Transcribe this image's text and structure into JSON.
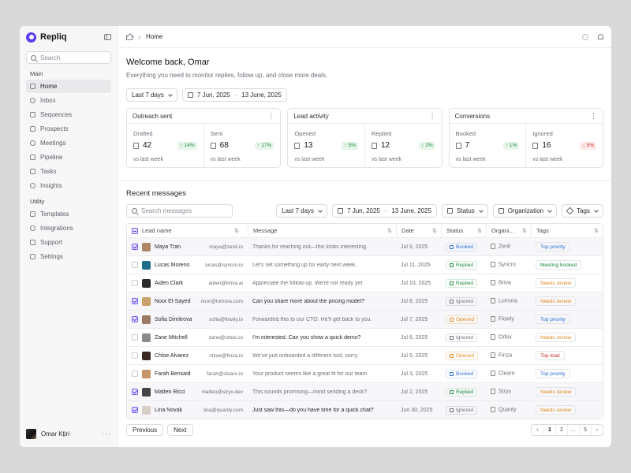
{
  "brand": {
    "name": "Repliq",
    "color": "#5b3df5"
  },
  "sidebar": {
    "search_placeholder": "Search",
    "main_label": "Main",
    "main_items": [
      {
        "label": "Home",
        "icon": "home-icon"
      },
      {
        "label": "Inbox",
        "icon": "inbox-icon"
      },
      {
        "label": "Sequences",
        "icon": "sequences-icon"
      },
      {
        "label": "Prospects",
        "icon": "prospects-icon"
      },
      {
        "label": "Meetings",
        "icon": "calendar-icon"
      },
      {
        "label": "Pipeline",
        "icon": "pipeline-icon"
      },
      {
        "label": "Tasks",
        "icon": "tasks-icon"
      },
      {
        "label": "Insights",
        "icon": "chart-icon"
      }
    ],
    "utility_label": "Utility",
    "utility_items": [
      {
        "label": "Templates",
        "icon": "templates-icon"
      },
      {
        "label": "Integrations",
        "icon": "integrations-icon"
      },
      {
        "label": "Support",
        "icon": "support-icon"
      },
      {
        "label": "Settings",
        "icon": "settings-icon"
      }
    ],
    "user": {
      "name": "Omar Kțiri"
    }
  },
  "topbar": {
    "crumb": "Home"
  },
  "header": {
    "welcome": "Welcome back, Omar",
    "subtitle": "Everything you need to monitor replies, follow up, and close more deals."
  },
  "filters": {
    "range": "Last 7 days",
    "date_from": "7 Jun, 2025",
    "date_to": "13 June, 2025"
  },
  "cards": [
    {
      "title": "Outreach sent",
      "metrics": [
        {
          "label": "Drafted",
          "value": "42",
          "delta": "14%",
          "dir": "up",
          "foot": "vs last week"
        },
        {
          "label": "Sent",
          "value": "68",
          "delta": "17%",
          "dir": "up",
          "foot": "vs last week"
        }
      ]
    },
    {
      "title": "Lead activity",
      "metrics": [
        {
          "label": "Opened",
          "value": "13",
          "delta": "5%",
          "dir": "up",
          "foot": "vs last week"
        },
        {
          "label": "Replied",
          "value": "12",
          "delta": "2%",
          "dir": "up",
          "foot": "vs last week"
        }
      ]
    },
    {
      "title": "Conversions",
      "metrics": [
        {
          "label": "Booked",
          "value": "7",
          "delta": "1%",
          "dir": "up",
          "foot": "vs last week"
        },
        {
          "label": "Ignored",
          "value": "16",
          "delta": "5%",
          "dir": "down",
          "foot": "vs last week"
        }
      ]
    }
  ],
  "messages": {
    "title": "Recent messages",
    "search_placeholder": "Search messages",
    "range": "Last 7 days",
    "date_from": "7 Jun, 2025",
    "date_to": "13 June, 2025",
    "status_filter": "Status",
    "org_filter": "Organization",
    "tags_filter": "Tags",
    "columns": {
      "lead": "Lead name",
      "message": "Message",
      "date": "Date",
      "status": "Status",
      "org": "Organi...",
      "tags": "Tags"
    },
    "rows": [
      {
        "name": "Maya Tran",
        "email": "maya@zenli.io",
        "message": "Thanks for reaching out—this looks interesting.",
        "strong": false,
        "date": "Jul 9, 2025",
        "status": "Booked",
        "status_kind": "booked",
        "org": "Zenli",
        "tag": "Top priority",
        "tag_kind": "blue",
        "checked": true,
        "face": "#b08866"
      },
      {
        "name": "Lucas Moreno",
        "email": "lucas@syncro.io",
        "message": "Let's set something up for early next week.",
        "strong": false,
        "date": "Jul 11, 2025",
        "status": "Replied",
        "status_kind": "replied",
        "org": "Syncro",
        "tag": "Meeting booked",
        "tag_kind": "green",
        "checked": false,
        "face": "#1e6e8c"
      },
      {
        "name": "Aiden Clark",
        "email": "aiden@briva.ai",
        "message": "Appreciate the follow-up. We're not ready yet.",
        "strong": false,
        "date": "Jul 10, 2025",
        "status": "Replied",
        "status_kind": "replied",
        "org": "Briva",
        "tag": "Needs review",
        "tag_kind": "orange",
        "checked": false,
        "face": "#2b2b2b"
      },
      {
        "name": "Noor El-Sayed",
        "email": "noor@lumora.com",
        "message": "Can you share more about the pricing model?",
        "strong": true,
        "date": "Jul 8, 2025",
        "status": "Ignored",
        "status_kind": "ignored",
        "org": "Lumora",
        "tag": "Needs review",
        "tag_kind": "orange",
        "checked": true,
        "face": "#c9a26a"
      },
      {
        "name": "Sofia Dimitrova",
        "email": "sofia@flowly.io",
        "message": "Forwarded this to our CTO. He'll get back to you.",
        "strong": false,
        "date": "Jul 7, 2025",
        "status": "Opened",
        "status_kind": "opened",
        "org": "Flowly",
        "tag": "Top priority",
        "tag_kind": "blue",
        "checked": true,
        "face": "#9a7b63"
      },
      {
        "name": "Zane Mitchell",
        "email": "zane@orbix.co",
        "message": "I'm interested. Can you show a quick demo?",
        "strong": true,
        "date": "Jul 6, 2025",
        "status": "Ignored",
        "status_kind": "ignored",
        "org": "Orbix",
        "tag": "Needs review",
        "tag_kind": "orange",
        "checked": false,
        "face": "#8a8a8a"
      },
      {
        "name": "Chloe Alvarez",
        "email": "chloe@finza.io",
        "message": "We've just onboarded a different tool, sorry.",
        "strong": false,
        "date": "Jul 5, 2025",
        "status": "Opened",
        "status_kind": "opened",
        "org": "Finza",
        "tag": "Top lead",
        "tag_kind": "red",
        "checked": false,
        "face": "#3a2a22"
      },
      {
        "name": "Farah Bensaid",
        "email": "farah@clearo.io",
        "message": "Your product seems like a great fit for our team.",
        "strong": false,
        "date": "Jul 3, 2025",
        "status": "Booked",
        "status_kind": "booked",
        "org": "Clearo",
        "tag": "Top priority",
        "tag_kind": "blue",
        "checked": false,
        "face": "#c8956a"
      },
      {
        "name": "Matteo Ricci",
        "email": "matteo@stryx.dev",
        "message": "This sounds promising—mind sending a deck?",
        "strong": false,
        "date": "Jul 2, 2025",
        "status": "Replied",
        "status_kind": "replied",
        "org": "Stryx",
        "tag": "Needs review",
        "tag_kind": "orange",
        "checked": true,
        "face": "#444444"
      },
      {
        "name": "Lina Novak",
        "email": "lina@quanty.com",
        "message": "Just saw this—do you have time for a quick chat?",
        "strong": true,
        "date": "Jun 30, 2025",
        "status": "Ignored",
        "status_kind": "ignored",
        "org": "Quanty",
        "tag": "Needs review",
        "tag_kind": "orange",
        "checked": true,
        "face": "#d8d0c8"
      }
    ]
  },
  "pager": {
    "prev": "Previous",
    "next": "Next",
    "pages": [
      "‹",
      "1",
      "2",
      "...",
      "5",
      "›"
    ],
    "current": "1"
  }
}
